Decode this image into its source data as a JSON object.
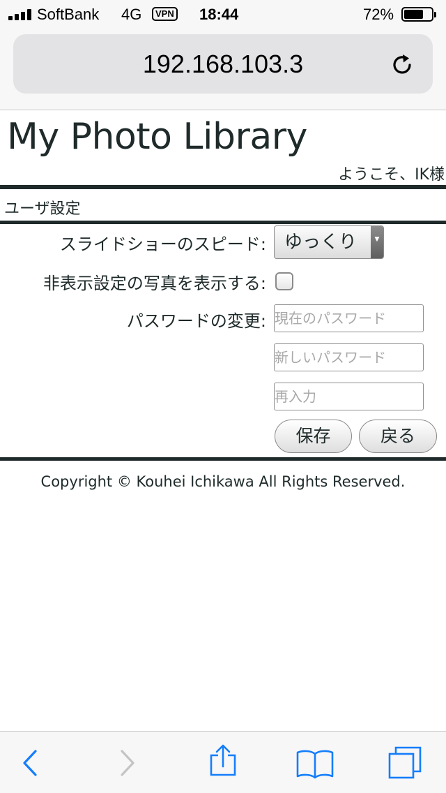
{
  "status_bar": {
    "carrier": "SoftBank",
    "network": "4G",
    "vpn": "VPN",
    "time": "18:44",
    "battery_percent": "72%",
    "battery_level": 0.72,
    "signal_bars": 4
  },
  "browser": {
    "url": "192.168.103.3",
    "reload_icon": "reload-icon"
  },
  "page": {
    "title": "My Photo Library",
    "welcome": "ようこそ、IK様",
    "section_title": "ユーザ設定",
    "slideshow_speed_label": "スライドショーのスピード:",
    "slideshow_speed_value": "ゆっくり",
    "show_hidden_label": "非表示設定の写真を表示する:",
    "show_hidden_checked": false,
    "password_label": "パスワードの変更:",
    "current_password_placeholder": "現在のパスワード",
    "new_password_placeholder": "新しいパスワード",
    "reenter_placeholder": "再入力",
    "save_label": "保存",
    "back_label": "戻る",
    "copyright": "Copyright © Kouhei Ichikawa All Rights Reserved."
  },
  "toolbar": {
    "back_icon": "chevron-left-icon",
    "forward_icon": "chevron-right-icon",
    "share_icon": "share-icon",
    "bookmarks_icon": "book-icon",
    "tabs_icon": "tabs-icon"
  },
  "colors": {
    "accent": "#147efb",
    "text": "#1f2a2a",
    "disabled": "#c4c4c6"
  }
}
